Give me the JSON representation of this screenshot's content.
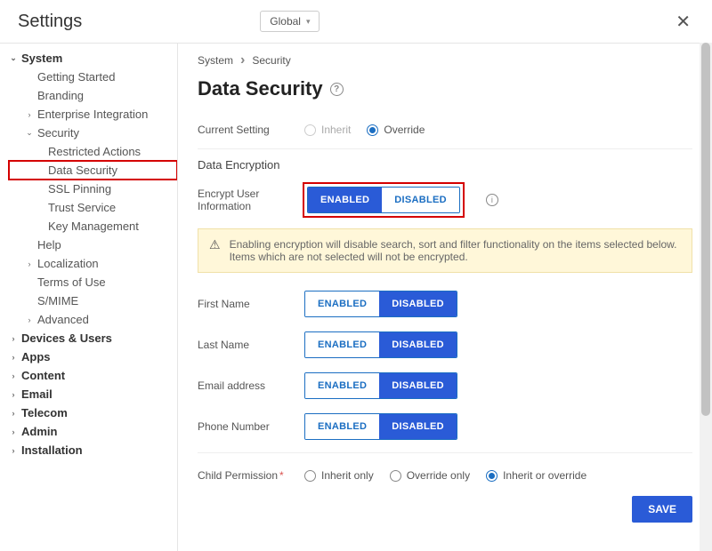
{
  "header": {
    "title": "Settings",
    "scope_label": "Global"
  },
  "sidebar": {
    "items": [
      {
        "label": "System",
        "level": 0,
        "expander": "down"
      },
      {
        "label": "Getting Started",
        "level": 1,
        "expander": "none"
      },
      {
        "label": "Branding",
        "level": 1,
        "expander": "none"
      },
      {
        "label": "Enterprise Integration",
        "level": 1,
        "expander": "right"
      },
      {
        "label": "Security",
        "level": 1,
        "expander": "down"
      },
      {
        "label": "Restricted Actions",
        "level": 2,
        "expander": "none"
      },
      {
        "label": "Data Security",
        "level": 2,
        "expander": "none",
        "highlight": true
      },
      {
        "label": "SSL Pinning",
        "level": 2,
        "expander": "none"
      },
      {
        "label": "Trust Service",
        "level": 2,
        "expander": "none"
      },
      {
        "label": "Key Management",
        "level": 2,
        "expander": "none"
      },
      {
        "label": "Help",
        "level": 1,
        "expander": "none"
      },
      {
        "label": "Localization",
        "level": 1,
        "expander": "right"
      },
      {
        "label": "Terms of Use",
        "level": 1,
        "expander": "none"
      },
      {
        "label": "S/MIME",
        "level": 1,
        "expander": "none"
      },
      {
        "label": "Advanced",
        "level": 1,
        "expander": "right"
      },
      {
        "label": "Devices & Users",
        "level": 0,
        "expander": "right"
      },
      {
        "label": "Apps",
        "level": 0,
        "expander": "right"
      },
      {
        "label": "Content",
        "level": 0,
        "expander": "right"
      },
      {
        "label": "Email",
        "level": 0,
        "expander": "right"
      },
      {
        "label": "Telecom",
        "level": 0,
        "expander": "right"
      },
      {
        "label": "Admin",
        "level": 0,
        "expander": "right"
      },
      {
        "label": "Installation",
        "level": 0,
        "expander": "right"
      }
    ]
  },
  "breadcrumb": {
    "items": [
      "System",
      "Security"
    ]
  },
  "page": {
    "title": "Data Security"
  },
  "form": {
    "current_setting_label": "Current Setting",
    "inherit_label": "Inherit",
    "override_label": "Override",
    "current_setting_value": "override",
    "section_encryption": "Data Encryption",
    "encrypt_user_label_1": "Encrypt User",
    "encrypt_user_label_2": "Information",
    "enabled_label": "ENABLED",
    "disabled_label": "DISABLED",
    "warning_text": "Enabling encryption will disable search, sort and filter functionality on the items selected below. Items which are not selected will not be encrypted.",
    "fields": [
      {
        "key": "first_name",
        "label": "First Name",
        "value": "disabled"
      },
      {
        "key": "last_name",
        "label": "Last Name",
        "value": "disabled"
      },
      {
        "key": "email",
        "label": "Email address",
        "value": "disabled"
      },
      {
        "key": "phone",
        "label": "Phone Number",
        "value": "disabled"
      }
    ],
    "child_permission_label": "Child Permission",
    "child_permission_options": {
      "inherit_only": "Inherit only",
      "override_only": "Override only",
      "inherit_or_override": "Inherit or override"
    },
    "child_permission_value": "inherit_or_override",
    "save_label": "SAVE"
  }
}
